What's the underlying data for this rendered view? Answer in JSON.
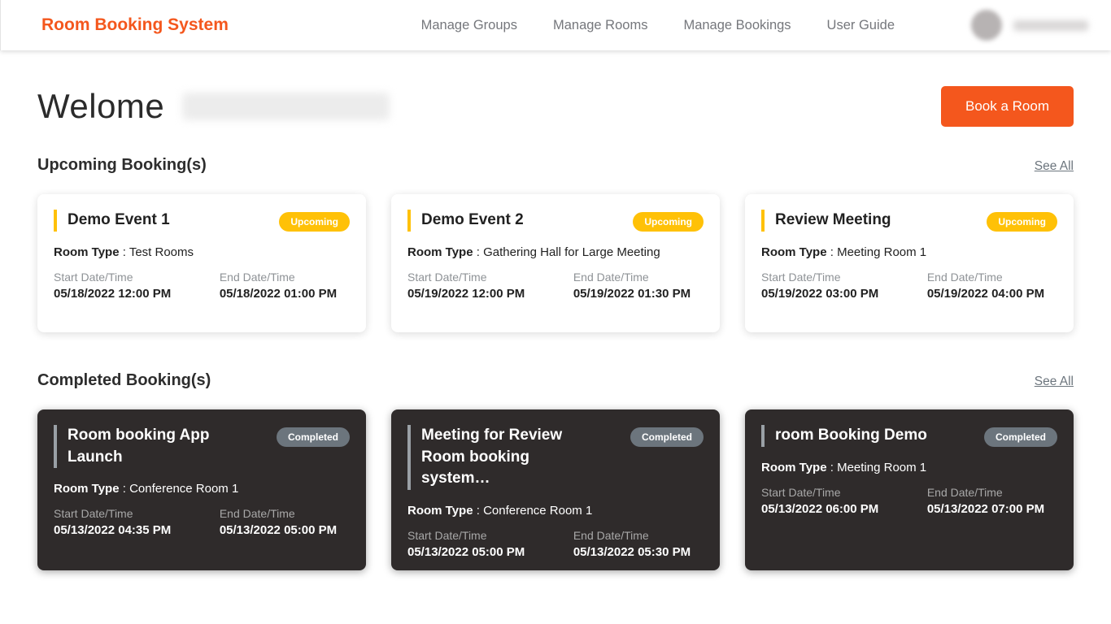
{
  "colors": {
    "brand_orange": "#f4571d",
    "badge_upcoming": "#ffc107",
    "badge_completed": "#6c757d",
    "completed_card_bg": "#2f2b2b"
  },
  "header": {
    "brand": "Room Booking System",
    "nav": [
      {
        "label": "Manage Groups"
      },
      {
        "label": "Manage Rooms"
      },
      {
        "label": "Manage Bookings"
      },
      {
        "label": "User Guide"
      }
    ]
  },
  "welcome": {
    "greeting": "Welome",
    "book_button": "Book a Room"
  },
  "labels": {
    "room_type": "Room Type",
    "separator": ":",
    "start": "Start Date/Time",
    "end": "End Date/Time"
  },
  "sections": [
    {
      "title": "Upcoming Booking(s)",
      "see_all": "See All",
      "cards": [
        {
          "title": "Demo Event 1",
          "badge": "Upcoming",
          "room_type": "Test Rooms",
          "start": "05/18/2022 12:00 PM",
          "end": "05/18/2022 01:00 PM"
        },
        {
          "title": "Demo Event 2",
          "badge": "Upcoming",
          "room_type": "Gathering Hall for Large Meeting",
          "start": "05/19/2022 12:00 PM",
          "end": "05/19/2022 01:30 PM"
        },
        {
          "title": "Review Meeting",
          "badge": "Upcoming",
          "room_type": "Meeting Room 1",
          "start": "05/19/2022 03:00 PM",
          "end": "05/19/2022 04:00 PM"
        }
      ]
    },
    {
      "title": "Completed Booking(s)",
      "see_all": "See All",
      "cards": [
        {
          "title": "Room booking App Launch",
          "badge": "Completed",
          "room_type": "Conference Room 1",
          "start": "05/13/2022 04:35 PM",
          "end": "05/13/2022 05:00 PM"
        },
        {
          "title": "Meeting for Review Room booking system…",
          "badge": "Completed",
          "room_type": "Conference Room 1",
          "start": "05/13/2022 05:00 PM",
          "end": "05/13/2022 05:30 PM"
        },
        {
          "title": "room Booking Demo",
          "badge": "Completed",
          "room_type": "Meeting Room 1",
          "start": "05/13/2022 06:00 PM",
          "end": "05/13/2022 07:00 PM"
        }
      ]
    }
  ]
}
